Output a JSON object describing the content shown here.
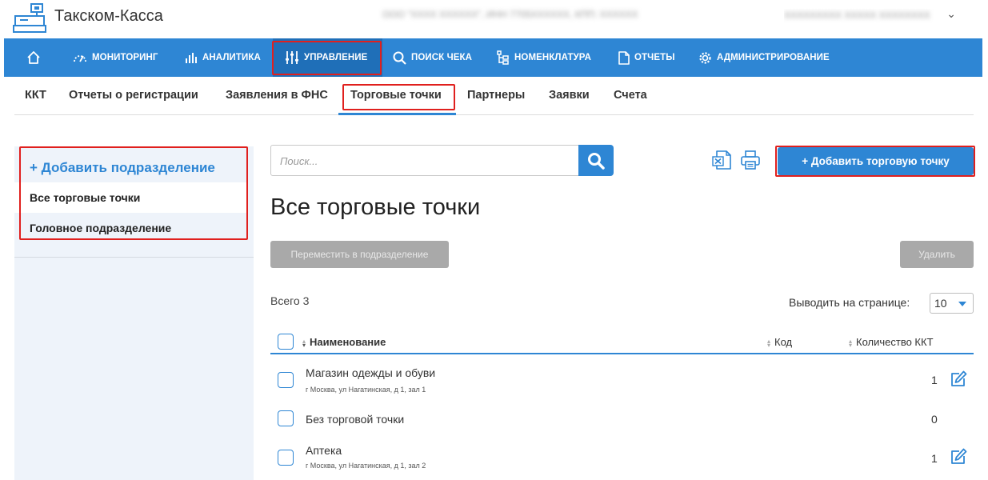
{
  "header": {
    "app_title": "Такском-Касса",
    "org_info": "ООО \"ХХХХ ХХХХХХ\", ИНН 7705ХХХХХХ, КПП: ХХХХХХ",
    "user_name": "ХХХХХХХХХ ХХХХХ ХХХХХХХХ"
  },
  "main_nav": {
    "items": [
      {
        "label": "МОНИТОРИНГ",
        "icon": "gauge-icon"
      },
      {
        "label": "АНАЛИТИКА",
        "icon": "bar-chart-icon"
      },
      {
        "label": "УПРАВЛЕНИЕ",
        "icon": "sliders-icon",
        "active": true
      },
      {
        "label": "ПОИСК ЧЕКА",
        "icon": "search-icon"
      },
      {
        "label": "НОМЕНКЛАТУРА",
        "icon": "hierarchy-icon"
      },
      {
        "label": "ОТЧЕТЫ",
        "icon": "document-icon"
      },
      {
        "label": "АДМИНИСТРИРОВАНИЕ",
        "icon": "gear-icon"
      }
    ]
  },
  "sub_nav": {
    "items": [
      {
        "label": "ККТ"
      },
      {
        "label": "Отчеты о регистрации"
      },
      {
        "label": "Заявления в ФНС"
      },
      {
        "label": "Торговые точки",
        "active": true
      },
      {
        "label": "Партнеры"
      },
      {
        "label": "Заявки"
      },
      {
        "label": "Счета"
      }
    ]
  },
  "sidebar": {
    "add_label": "+ Добавить подразделение",
    "items": [
      {
        "label": "Все торговые точки"
      },
      {
        "label": "Головное подразделение"
      }
    ]
  },
  "toolbar": {
    "search_placeholder": "Поиск...",
    "add_label": "+ Добавить торговую точку"
  },
  "main": {
    "title": "Все торговые точки",
    "move_label": "Переместить в подразделение",
    "delete_label": "Удалить",
    "total": "Всего 3",
    "per_page_label": "Выводить на странице:",
    "per_page_value": "10"
  },
  "table": {
    "columns": {
      "name": "Наименование",
      "code": "Код",
      "kkt_count": "Количество ККТ"
    },
    "rows": [
      {
        "name": "Магазин одежды и обуви",
        "address": "г Москва, ул Нагатинская, д 1, зал 1",
        "count": "1",
        "editable": true
      },
      {
        "name": "Без торговой точки",
        "address": "",
        "count": "0",
        "editable": false
      },
      {
        "name": "Аптека",
        "address": "г Москва, ул Нагатинская, д 1, зал 2",
        "count": "1",
        "editable": true
      }
    ]
  },
  "colors": {
    "accent": "#2e86d4",
    "nav_active": "#1f6fb8",
    "highlight": "#e0201e",
    "sidebar_bg": "#eef3fa",
    "disabled_button": "#a9a9a9"
  }
}
